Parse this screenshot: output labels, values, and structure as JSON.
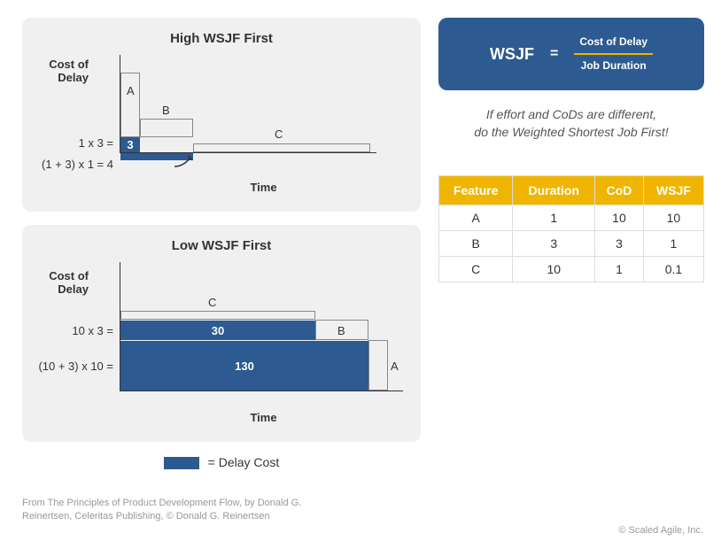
{
  "chart_data": [
    {
      "type": "bar",
      "title": "High WSJF First",
      "xlabel": "Time",
      "ylabel": "Cost of Delay",
      "series": [
        {
          "name": "A",
          "duration": 1,
          "cod": 10,
          "delay_cost": 0
        },
        {
          "name": "B",
          "duration": 3,
          "cod": 3,
          "delay_cost": 3,
          "calc": "1 x 3 ="
        },
        {
          "name": "C",
          "duration": 10,
          "cod": 1,
          "delay_cost": 4,
          "calc": "(1 + 3) x 1 ="
        }
      ]
    },
    {
      "type": "bar",
      "title": "Low WSJF First",
      "xlabel": "Time",
      "ylabel": "Cost of Delay",
      "series": [
        {
          "name": "C",
          "duration": 10,
          "cod": 1,
          "delay_cost": 0
        },
        {
          "name": "B",
          "duration": 3,
          "cod": 3,
          "delay_cost": 30,
          "calc": "10 x 3 ="
        },
        {
          "name": "A",
          "duration": 1,
          "cod": 10,
          "delay_cost": 130,
          "calc": "(10 + 3) x 10 ="
        }
      ]
    }
  ],
  "legend": {
    "label": "= Delay Cost"
  },
  "formula": {
    "lhs": "WSJF",
    "eq": "=",
    "numerator": "Cost of Delay",
    "denominator": "Job Duration"
  },
  "tagline": "If effort and CoDs are different,\ndo the Weighted Shortest Job First!",
  "table": {
    "headers": [
      "Feature",
      "Duration",
      "CoD",
      "WSJF"
    ],
    "rows": [
      [
        "A",
        "1",
        "10",
        "10"
      ],
      [
        "B",
        "3",
        "3",
        "1"
      ],
      [
        "C",
        "10",
        "1",
        "0.1"
      ]
    ]
  },
  "citation": "From The Principles of Product Development Flow, by Donald G. Reinertsen, Celeritas Publishing, © Donald G. Reinertsen",
  "copyright": "© Scaled Agile, Inc."
}
